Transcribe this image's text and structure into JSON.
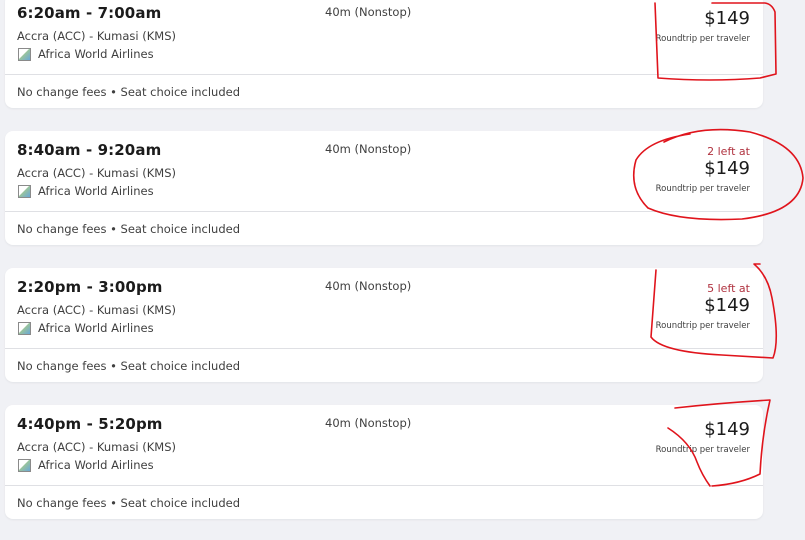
{
  "flights": [
    {
      "times": "6:20am - 7:00am",
      "route": "Accra (ACC) - Kumasi (KMS)",
      "airline": "Africa World Airlines",
      "airline_logo_icon": "airline-logo-icon",
      "duration": "40m (Nonstop)",
      "seats_left": "",
      "price": "$149",
      "price_note": "Roundtrip per traveler",
      "fees": "No change fees • Seat choice included"
    },
    {
      "times": "8:40am - 9:20am",
      "route": "Accra (ACC) - Kumasi (KMS)",
      "airline": "Africa World Airlines",
      "airline_logo_icon": "airline-logo-icon",
      "duration": "40m (Nonstop)",
      "seats_left": "2 left at",
      "price": "$149",
      "price_note": "Roundtrip per traveler",
      "fees": "No change fees • Seat choice included"
    },
    {
      "times": "2:20pm - 3:00pm",
      "route": "Accra (ACC) - Kumasi (KMS)",
      "airline": "Africa World Airlines",
      "airline_logo_icon": "airline-logo-icon",
      "duration": "40m (Nonstop)",
      "seats_left": "5 left at",
      "price": "$149",
      "price_note": "Roundtrip per traveler",
      "fees": "No change fees • Seat choice included"
    },
    {
      "times": "4:40pm - 5:20pm",
      "route": "Accra (ACC) - Kumasi (KMS)",
      "airline": "Africa World Airlines",
      "airline_logo_icon": "airline-logo-icon",
      "duration": "40m (Nonstop)",
      "seats_left": "",
      "price": "$149",
      "price_note": "Roundtrip per traveler",
      "fees": "No change fees • Seat choice included"
    }
  ],
  "colors": {
    "page_background": "#f0f1f5",
    "card_background": "#ffffff",
    "seats_left_text": "#b0323f",
    "annotation_ink": "#e0141c"
  }
}
